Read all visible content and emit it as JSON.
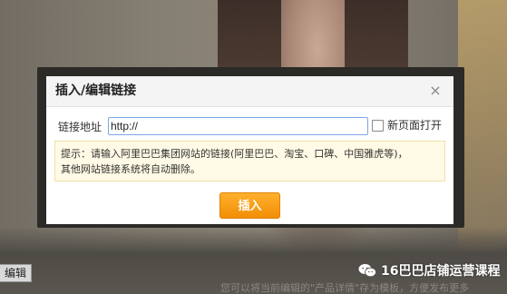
{
  "background": {
    "edit_label": "编辑",
    "bottom_hint": "您可以将当前编辑的\"产品详情\"存为模板，方便发布更多"
  },
  "watermark": {
    "icon": "wechat-icon",
    "text": "16巴巴店铺运营课程"
  },
  "dialog": {
    "title": "插入/编辑链接",
    "close_icon": "close-icon",
    "close_glyph": "×",
    "link_label": "链接地址",
    "link_value": "http://",
    "new_window_label": "新页面打开",
    "new_window_checked": false,
    "tip_line1": "提示：请输入阿里巴巴集团网站的链接(阿里巴巴、淘宝、口碑、中国雅虎等)，",
    "tip_line2": "其他网站链接系统将自动删除。",
    "insert_label": "插入"
  },
  "colors": {
    "accent": "#f5960a",
    "input_border": "#7aa7e4",
    "tip_background": "#fffae5"
  }
}
